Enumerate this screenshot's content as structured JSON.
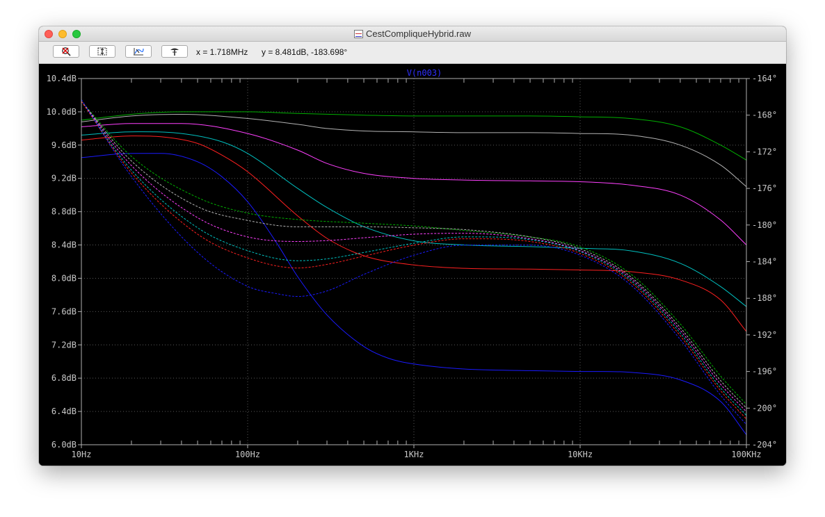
{
  "window": {
    "title": "CestCompliqueHybrid.raw"
  },
  "toolbar": {
    "buttons": [
      {
        "name": "zoom-full-icon"
      },
      {
        "name": "zoom-vertical-icon"
      },
      {
        "name": "zoom-cursor-icon"
      },
      {
        "name": "probe-icon"
      }
    ],
    "x_readout": "x = 1.718MHz",
    "y_readout": "y = 8.481dB, -183.698°"
  },
  "chart_data": {
    "type": "line",
    "title": "V(n003)",
    "x_scale": "log",
    "xlim": [
      10,
      100000
    ],
    "ylim_left": [
      6.0,
      10.4
    ],
    "ylim_right": [
      -204,
      -164
    ],
    "grid": true,
    "x_ticks": [
      {
        "value": 10,
        "label": "10Hz"
      },
      {
        "value": 100,
        "label": "100Hz"
      },
      {
        "value": 1000,
        "label": "1KHz"
      },
      {
        "value": 10000,
        "label": "10KHz"
      },
      {
        "value": 100000,
        "label": "100KHz"
      }
    ],
    "y_ticks_left": [
      {
        "value": 10.4,
        "label": "10.4dB"
      },
      {
        "value": 10.0,
        "label": "10.0dB"
      },
      {
        "value": 9.6,
        "label": "9.6dB"
      },
      {
        "value": 9.2,
        "label": "9.2dB"
      },
      {
        "value": 8.8,
        "label": "8.8dB"
      },
      {
        "value": 8.4,
        "label": "8.4dB"
      },
      {
        "value": 8.0,
        "label": "8.0dB"
      },
      {
        "value": 7.6,
        "label": "7.6dB"
      },
      {
        "value": 7.2,
        "label": "7.2dB"
      },
      {
        "value": 6.8,
        "label": "6.8dB"
      },
      {
        "value": 6.4,
        "label": "6.4dB"
      },
      {
        "value": 6.0,
        "label": "6.0dB"
      }
    ],
    "y_ticks_right": [
      {
        "value": -164,
        "label": "-164°"
      },
      {
        "value": -168,
        "label": "-168°"
      },
      {
        "value": -172,
        "label": "-172°"
      },
      {
        "value": -176,
        "label": "-176°"
      },
      {
        "value": -180,
        "label": "-180°"
      },
      {
        "value": -184,
        "label": "-184°"
      },
      {
        "value": -188,
        "label": "-188°"
      },
      {
        "value": -192,
        "label": "-192°"
      },
      {
        "value": -196,
        "label": "-196°"
      },
      {
        "value": -200,
        "label": "-200°"
      },
      {
        "value": -204,
        "label": "-204°"
      }
    ],
    "series": [
      {
        "axis": "left",
        "color": "#00b000",
        "style": "solid",
        "x": [
          10,
          20,
          40,
          100,
          200,
          500,
          1000,
          2000,
          5000,
          10000,
          20000,
          40000,
          70000,
          100000
        ],
        "y": [
          9.9,
          9.97,
          10.0,
          10.0,
          9.98,
          9.96,
          9.95,
          9.95,
          9.95,
          9.94,
          9.92,
          9.82,
          9.6,
          9.42
        ]
      },
      {
        "axis": "left",
        "color": "#b4b4b4",
        "style": "solid",
        "x": [
          10,
          20,
          40,
          100,
          200,
          300,
          500,
          1000,
          2000,
          5000,
          10000,
          20000,
          40000,
          70000,
          100000
        ],
        "y": [
          9.88,
          9.95,
          9.97,
          9.92,
          9.85,
          9.8,
          9.77,
          9.76,
          9.75,
          9.75,
          9.74,
          9.72,
          9.6,
          9.36,
          9.1
        ]
      },
      {
        "axis": "left",
        "color": "#ff40ff",
        "style": "solid",
        "x": [
          10,
          20,
          40,
          100,
          200,
          300,
          500,
          1000,
          2000,
          5000,
          10000,
          20000,
          40000,
          70000,
          100000
        ],
        "y": [
          9.82,
          9.86,
          9.86,
          9.74,
          9.54,
          9.38,
          9.26,
          9.2,
          9.18,
          9.17,
          9.16,
          9.12,
          9.0,
          8.7,
          8.4
        ]
      },
      {
        "axis": "left",
        "color": "#00c0c0",
        "style": "solid",
        "x": [
          10,
          20,
          40,
          70,
          100,
          200,
          300,
          500,
          1000,
          2000,
          5000,
          10000,
          20000,
          40000,
          70000,
          100000
        ],
        "y": [
          9.72,
          9.76,
          9.74,
          9.64,
          9.5,
          9.08,
          8.85,
          8.62,
          8.45,
          8.4,
          8.38,
          8.36,
          8.33,
          8.18,
          7.9,
          7.66
        ]
      },
      {
        "axis": "left",
        "color": "#ff2020",
        "style": "solid",
        "x": [
          10,
          20,
          30,
          50,
          70,
          100,
          200,
          300,
          500,
          1000,
          2000,
          5000,
          10000,
          20000,
          40000,
          70000,
          100000
        ],
        "y": [
          9.66,
          9.71,
          9.7,
          9.62,
          9.48,
          9.28,
          8.75,
          8.48,
          8.27,
          8.16,
          8.12,
          8.11,
          8.1,
          8.08,
          7.98,
          7.74,
          7.36
        ]
      },
      {
        "axis": "left",
        "color": "#1a1aff",
        "style": "solid",
        "x": [
          10,
          20,
          30,
          50,
          70,
          100,
          150,
          200,
          300,
          500,
          700,
          1000,
          2000,
          5000,
          10000,
          20000,
          40000,
          70000,
          100000
        ],
        "y": [
          9.45,
          9.5,
          9.5,
          9.4,
          9.22,
          8.92,
          8.42,
          8.02,
          7.56,
          7.18,
          7.04,
          6.97,
          6.91,
          6.89,
          6.88,
          6.87,
          6.78,
          6.52,
          6.12
        ]
      },
      {
        "axis": "right",
        "color": "#00b000",
        "style": "dashed",
        "x": [
          10,
          20,
          50,
          100,
          200,
          500,
          1000,
          2000,
          5000,
          10000,
          20000,
          40000,
          70000,
          100000
        ],
        "y": [
          -166.5,
          -172.5,
          -177,
          -178.7,
          -179.4,
          -179.8,
          -180.1,
          -180.6,
          -181.3,
          -182.4,
          -185.3,
          -190.8,
          -196.5,
          -199.6
        ]
      },
      {
        "axis": "right",
        "color": "#b4b4b4",
        "style": "dashed",
        "x": [
          10,
          20,
          50,
          100,
          200,
          500,
          1000,
          2000,
          5000,
          10000,
          20000,
          40000,
          70000,
          100000
        ],
        "y": [
          -166.5,
          -173,
          -178,
          -179.5,
          -180.2,
          -180.2,
          -180.3,
          -180.5,
          -181.3,
          -182.6,
          -185.6,
          -191.2,
          -197,
          -200
        ]
      },
      {
        "axis": "right",
        "color": "#ff40ff",
        "style": "dashed",
        "x": [
          10,
          20,
          50,
          100,
          200,
          300,
          500,
          1000,
          2000,
          5000,
          10000,
          20000,
          40000,
          70000,
          100000
        ],
        "y": [
          -166.5,
          -173.5,
          -179.2,
          -181.3,
          -181.8,
          -181.7,
          -181.4,
          -181.0,
          -180.9,
          -181.5,
          -182.8,
          -185.8,
          -191.5,
          -197.4,
          -200.4
        ]
      },
      {
        "axis": "right",
        "color": "#00c0c0",
        "style": "dashed",
        "x": [
          10,
          20,
          50,
          100,
          200,
          300,
          500,
          1000,
          2000,
          5000,
          10000,
          20000,
          40000,
          70000,
          100000
        ],
        "y": [
          -166.5,
          -174,
          -180.3,
          -182.8,
          -183.9,
          -183.7,
          -183,
          -182,
          -181.3,
          -181.6,
          -182.9,
          -186,
          -191.8,
          -197.8,
          -200.8
        ]
      },
      {
        "axis": "right",
        "color": "#ff2020",
        "style": "dashed",
        "x": [
          10,
          20,
          50,
          100,
          200,
          300,
          500,
          1000,
          2000,
          5000,
          10000,
          20000,
          40000,
          70000,
          100000
        ],
        "y": [
          -166.5,
          -174.3,
          -181,
          -183.6,
          -184.7,
          -184.3,
          -183.4,
          -182.2,
          -181.5,
          -181.8,
          -183.1,
          -186.2,
          -192.1,
          -198.1,
          -201.2
        ]
      },
      {
        "axis": "right",
        "color": "#1a1aff",
        "style": "dashed",
        "x": [
          10,
          20,
          50,
          100,
          150,
          200,
          300,
          500,
          1000,
          2000,
          5000,
          10000,
          20000,
          40000,
          70000,
          100000
        ],
        "y": [
          -166.3,
          -174.7,
          -183,
          -186.7,
          -187.5,
          -187.8,
          -187.2,
          -185.4,
          -183.3,
          -182.2,
          -182.2,
          -183.3,
          -186.5,
          -192.5,
          -198.6,
          -201.8
        ]
      }
    ]
  }
}
